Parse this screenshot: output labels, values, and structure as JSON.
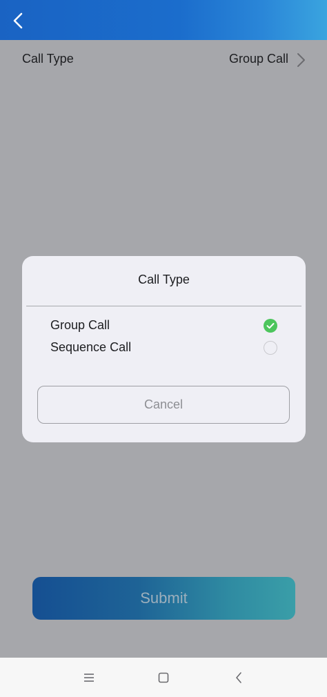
{
  "header": {
    "back_icon": "chevron-left-icon",
    "background_color": "#1b6dcc"
  },
  "call_type_row": {
    "label": "Call Type",
    "value": "Group Call",
    "chevron_icon": "chevron-right-icon"
  },
  "dialog": {
    "title": "Call Type",
    "options": [
      {
        "label": "Group Call",
        "selected": true
      },
      {
        "label": "Sequence Call",
        "selected": false
      }
    ],
    "cancel_label": "Cancel",
    "check_color": "#4cc55c"
  },
  "submit": {
    "label": "Submit"
  },
  "system_nav": {
    "icons": [
      "menu-icon",
      "home-icon",
      "back-icon"
    ]
  }
}
